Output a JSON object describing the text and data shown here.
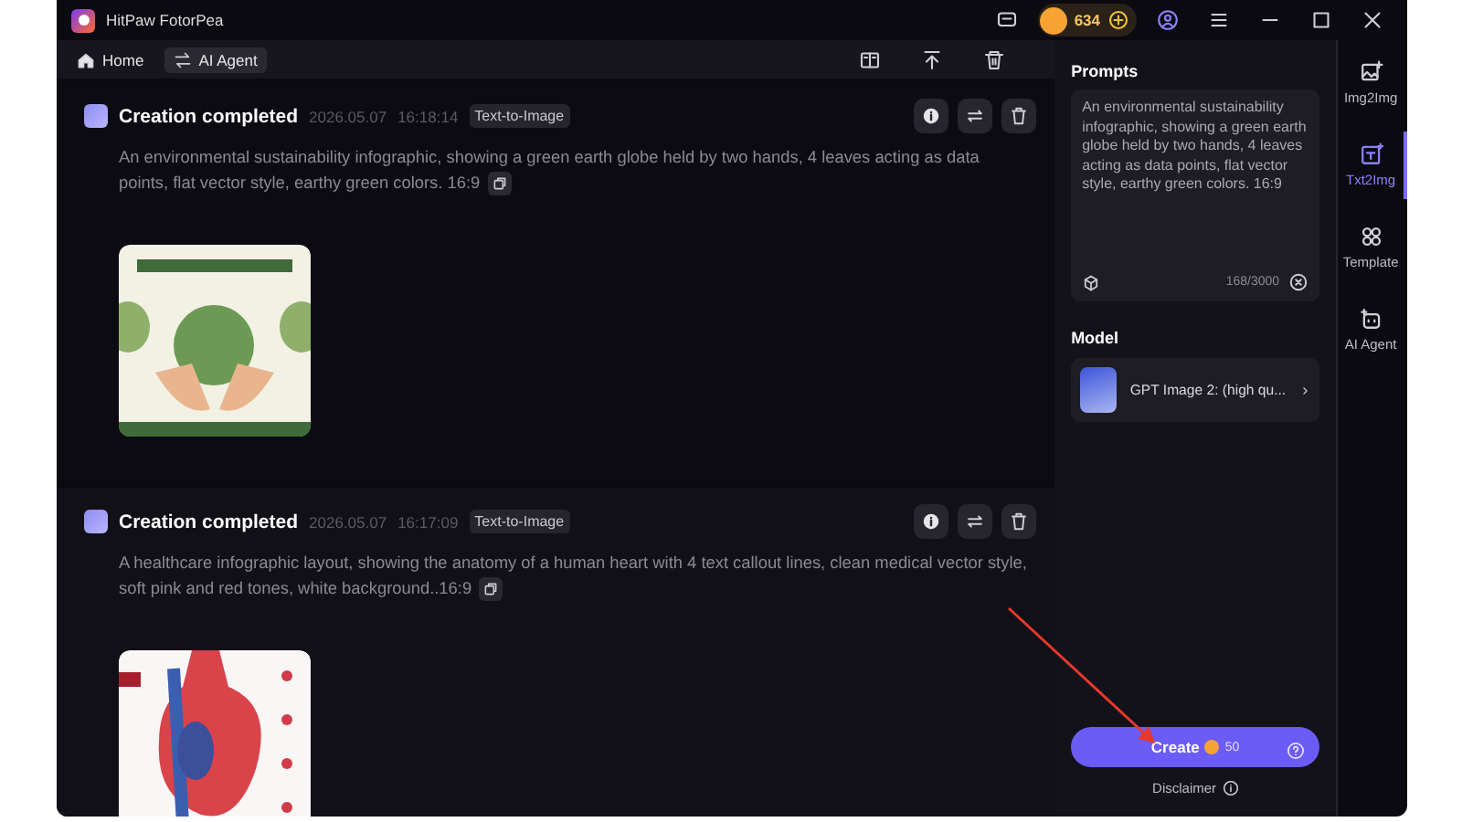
{
  "window": {
    "title": "HitPaw FotorPea",
    "coins": "634"
  },
  "toolbar": [
    {
      "label": "Home",
      "selected": false
    },
    {
      "label": "AI Agent",
      "selected": true
    }
  ],
  "feed": [
    {
      "status": "Creation completed",
      "date": "2026.05.07",
      "time": "16:18:14",
      "tag": "Text-to-Image",
      "prompt": "An environmental sustainability infographic, showing a green earth globe held by two hands, 4 leaves acting as data points, flat vector style, earthy green colors. 16:9",
      "kind": "globe"
    },
    {
      "status": "Creation completed",
      "date": "2026.05.07",
      "time": "16:17:09",
      "tag": "Text-to-Image",
      "prompt": "A healthcare infographic layout, showing the anatomy of a human heart with 4 text callout lines, clean medical vector style, soft pink and red tones, white background..16:9",
      "kind": "heart"
    }
  ],
  "prompts": {
    "title": "Prompts",
    "value": "An environmental sustainability infographic, showing a green earth globe held by two hands, 4 leaves acting as data points, flat vector style, earthy green colors. 16:9",
    "counter": "168/3000"
  },
  "model": {
    "title": "Model",
    "name": "GPT Image 2: (high qu..."
  },
  "create": {
    "label": "Create",
    "cost": "50"
  },
  "disclaimer": "Disclaimer",
  "rail": [
    {
      "label": "Img2Img",
      "selected": false
    },
    {
      "label": "Txt2Img",
      "selected": true
    },
    {
      "label": "Template",
      "selected": false
    },
    {
      "label": "AI Agent",
      "selected": false
    }
  ]
}
